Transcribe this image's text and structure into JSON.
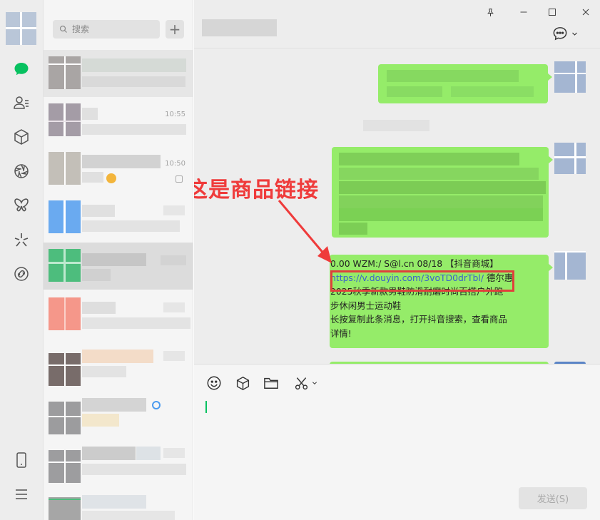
{
  "search": {
    "placeholder": "搜索"
  },
  "add_label": "+",
  "conversations": [
    {
      "time": ""
    },
    {
      "time": "10:55"
    },
    {
      "time": "10:50"
    },
    {
      "time": ""
    },
    {
      "time": ""
    },
    {
      "time": ""
    },
    {
      "time": ""
    },
    {
      "time": ""
    },
    {
      "time": ""
    },
    {
      "time": ""
    }
  ],
  "message": {
    "lines": [
      "0.00 WZM:/ S@l.cn 08/18 【抖音商城】",
      "https://v.douyin.com/3voTD0drTbl/ 德尔惠",
      "2025秋季新款男鞋防滑耐磨时尚百搭户外跑",
      "步休闲男士运动鞋",
      "长按复制此条消息，打开抖音搜索，查看商品",
      "详情!"
    ],
    "link": "https://v.douyin.com/3voTD0drTbl/"
  },
  "annotation": {
    "label": "这是商品链接",
    "color": "#ef3b3b"
  },
  "composer": {
    "send_label": "发送(S)"
  },
  "colors": {
    "bubble": "#95ec69",
    "accent": "#07c160",
    "highlight": "#e0403b"
  },
  "icons": [
    "chat-icon",
    "contacts-icon",
    "cube-icon",
    "shutter-icon",
    "butterfly-icon",
    "sparkle-icon",
    "link-icon",
    "phone-icon",
    "menu-icon",
    "search-icon",
    "pin-icon",
    "minimize-icon",
    "maximize-icon",
    "close-icon",
    "more-icon",
    "emoji-icon",
    "folder-icon",
    "scissors-icon"
  ]
}
